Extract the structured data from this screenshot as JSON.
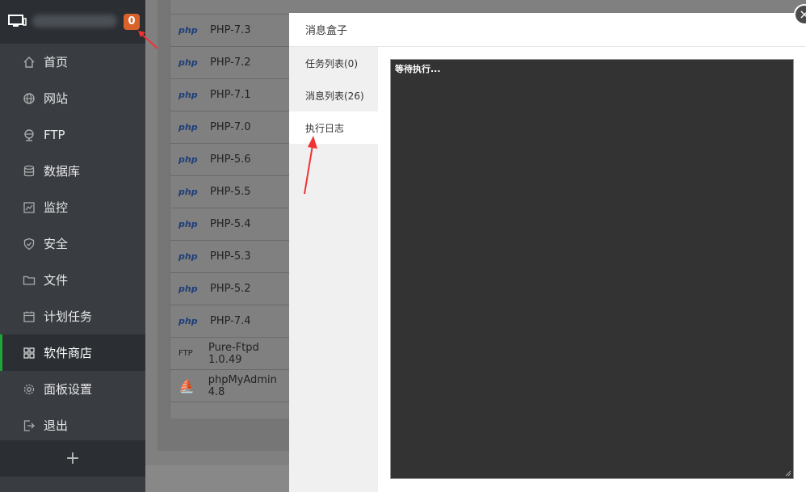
{
  "sidebar": {
    "badge_count": "0",
    "items": [
      {
        "label": "首页",
        "icon": "home-icon"
      },
      {
        "label": "网站",
        "icon": "globe-icon"
      },
      {
        "label": "FTP",
        "icon": "ftp-icon"
      },
      {
        "label": "数据库",
        "icon": "database-icon"
      },
      {
        "label": "监控",
        "icon": "monitor-chart-icon"
      },
      {
        "label": "安全",
        "icon": "shield-icon"
      },
      {
        "label": "文件",
        "icon": "folder-icon"
      },
      {
        "label": "计划任务",
        "icon": "calendar-icon"
      },
      {
        "label": "软件商店",
        "icon": "grid-icon"
      },
      {
        "label": "面板设置",
        "icon": "gear-icon"
      },
      {
        "label": "退出",
        "icon": "logout-icon"
      }
    ],
    "active_item": "软件商店",
    "add_label": "+"
  },
  "software_list": [
    {
      "logo": "php",
      "name": "PHP-7.3"
    },
    {
      "logo": "php",
      "name": "PHP-7.2"
    },
    {
      "logo": "php",
      "name": "PHP-7.1"
    },
    {
      "logo": "php",
      "name": "PHP-7.0"
    },
    {
      "logo": "php",
      "name": "PHP-5.6"
    },
    {
      "logo": "php",
      "name": "PHP-5.5"
    },
    {
      "logo": "php",
      "name": "PHP-5.4"
    },
    {
      "logo": "php",
      "name": "PHP-5.3"
    },
    {
      "logo": "php",
      "name": "PHP-5.2"
    },
    {
      "logo": "php",
      "name": "PHP-7.4"
    },
    {
      "logo": "FTP",
      "name": "Pure-Ftpd 1.0.49"
    },
    {
      "logo": "pma",
      "name": "phpMyAdmin 4.8"
    }
  ],
  "modal": {
    "title": "消息盒子",
    "close_label": "×",
    "tabs": [
      {
        "label": "任务列表(0)"
      },
      {
        "label": "消息列表(26)"
      },
      {
        "label": "执行日志"
      }
    ],
    "active_tab": "执行日志",
    "log_text": "等待执行..."
  },
  "colors": {
    "sidebar_bg": "#393d42",
    "accent_green": "#20a53a",
    "badge_orange": "#d9622b",
    "annotation_red": "#f03333"
  }
}
